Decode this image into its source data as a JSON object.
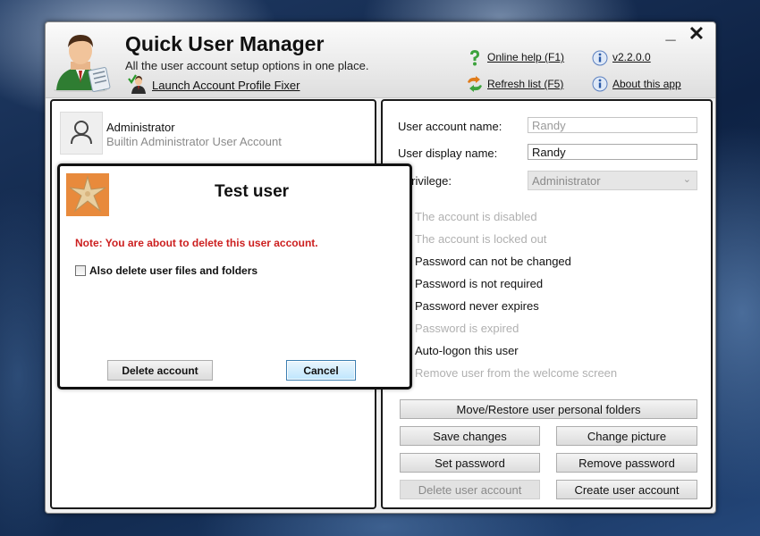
{
  "header": {
    "title": "Quick User Manager",
    "subtitle": "All the user account setup options in one place.",
    "fixer_link": "Launch Account Profile Fixer",
    "online_help": "Online help (F1)",
    "refresh_list": "Refresh list (F5)",
    "version": "v2.2.0.0",
    "about": "About this app",
    "minimize": "_",
    "close": "✕"
  },
  "user_list": {
    "items": [
      {
        "name": "Administrator",
        "description": "Builtin Administrator User Account",
        "icon": "user-silhouette-icon"
      }
    ]
  },
  "details": {
    "account_name_label": "User account name:",
    "account_name_value": "Randy",
    "display_name_label": "User display name:",
    "display_name_value": "Randy",
    "privilege_label": "r privilege:",
    "privilege_value": "Administrator",
    "options": [
      {
        "label": "The account is disabled",
        "enabled": false
      },
      {
        "label": "The account is locked out",
        "enabled": false
      },
      {
        "label": "Password can not be changed",
        "enabled": true
      },
      {
        "label": "Password is not required",
        "enabled": true
      },
      {
        "label": "Password never expires",
        "enabled": true
      },
      {
        "label": "Password is expired",
        "enabled": false
      },
      {
        "label": "Auto-logon this user",
        "enabled": true
      },
      {
        "label": "Remove user from the welcome screen",
        "enabled": false
      }
    ],
    "buttons": {
      "move_restore": "Move/Restore user personal folders",
      "save_changes": "Save changes",
      "change_picture": "Change picture",
      "set_password": "Set password",
      "remove_password": "Remove password",
      "delete_account": "Delete user account",
      "create_account": "Create user account"
    }
  },
  "dialog": {
    "title": "Test user",
    "note": "Note: You are about to delete this user account.",
    "checkbox_label": "Also delete user files and folders",
    "checkbox_checked": false,
    "delete_button": "Delete account",
    "cancel_button": "Cancel",
    "picture": "starfish-icon"
  },
  "colors": {
    "note_red": "#cc1f1f",
    "cancel_focus_border": "#3c7fb1",
    "panel_border": "#1a1a1a"
  }
}
